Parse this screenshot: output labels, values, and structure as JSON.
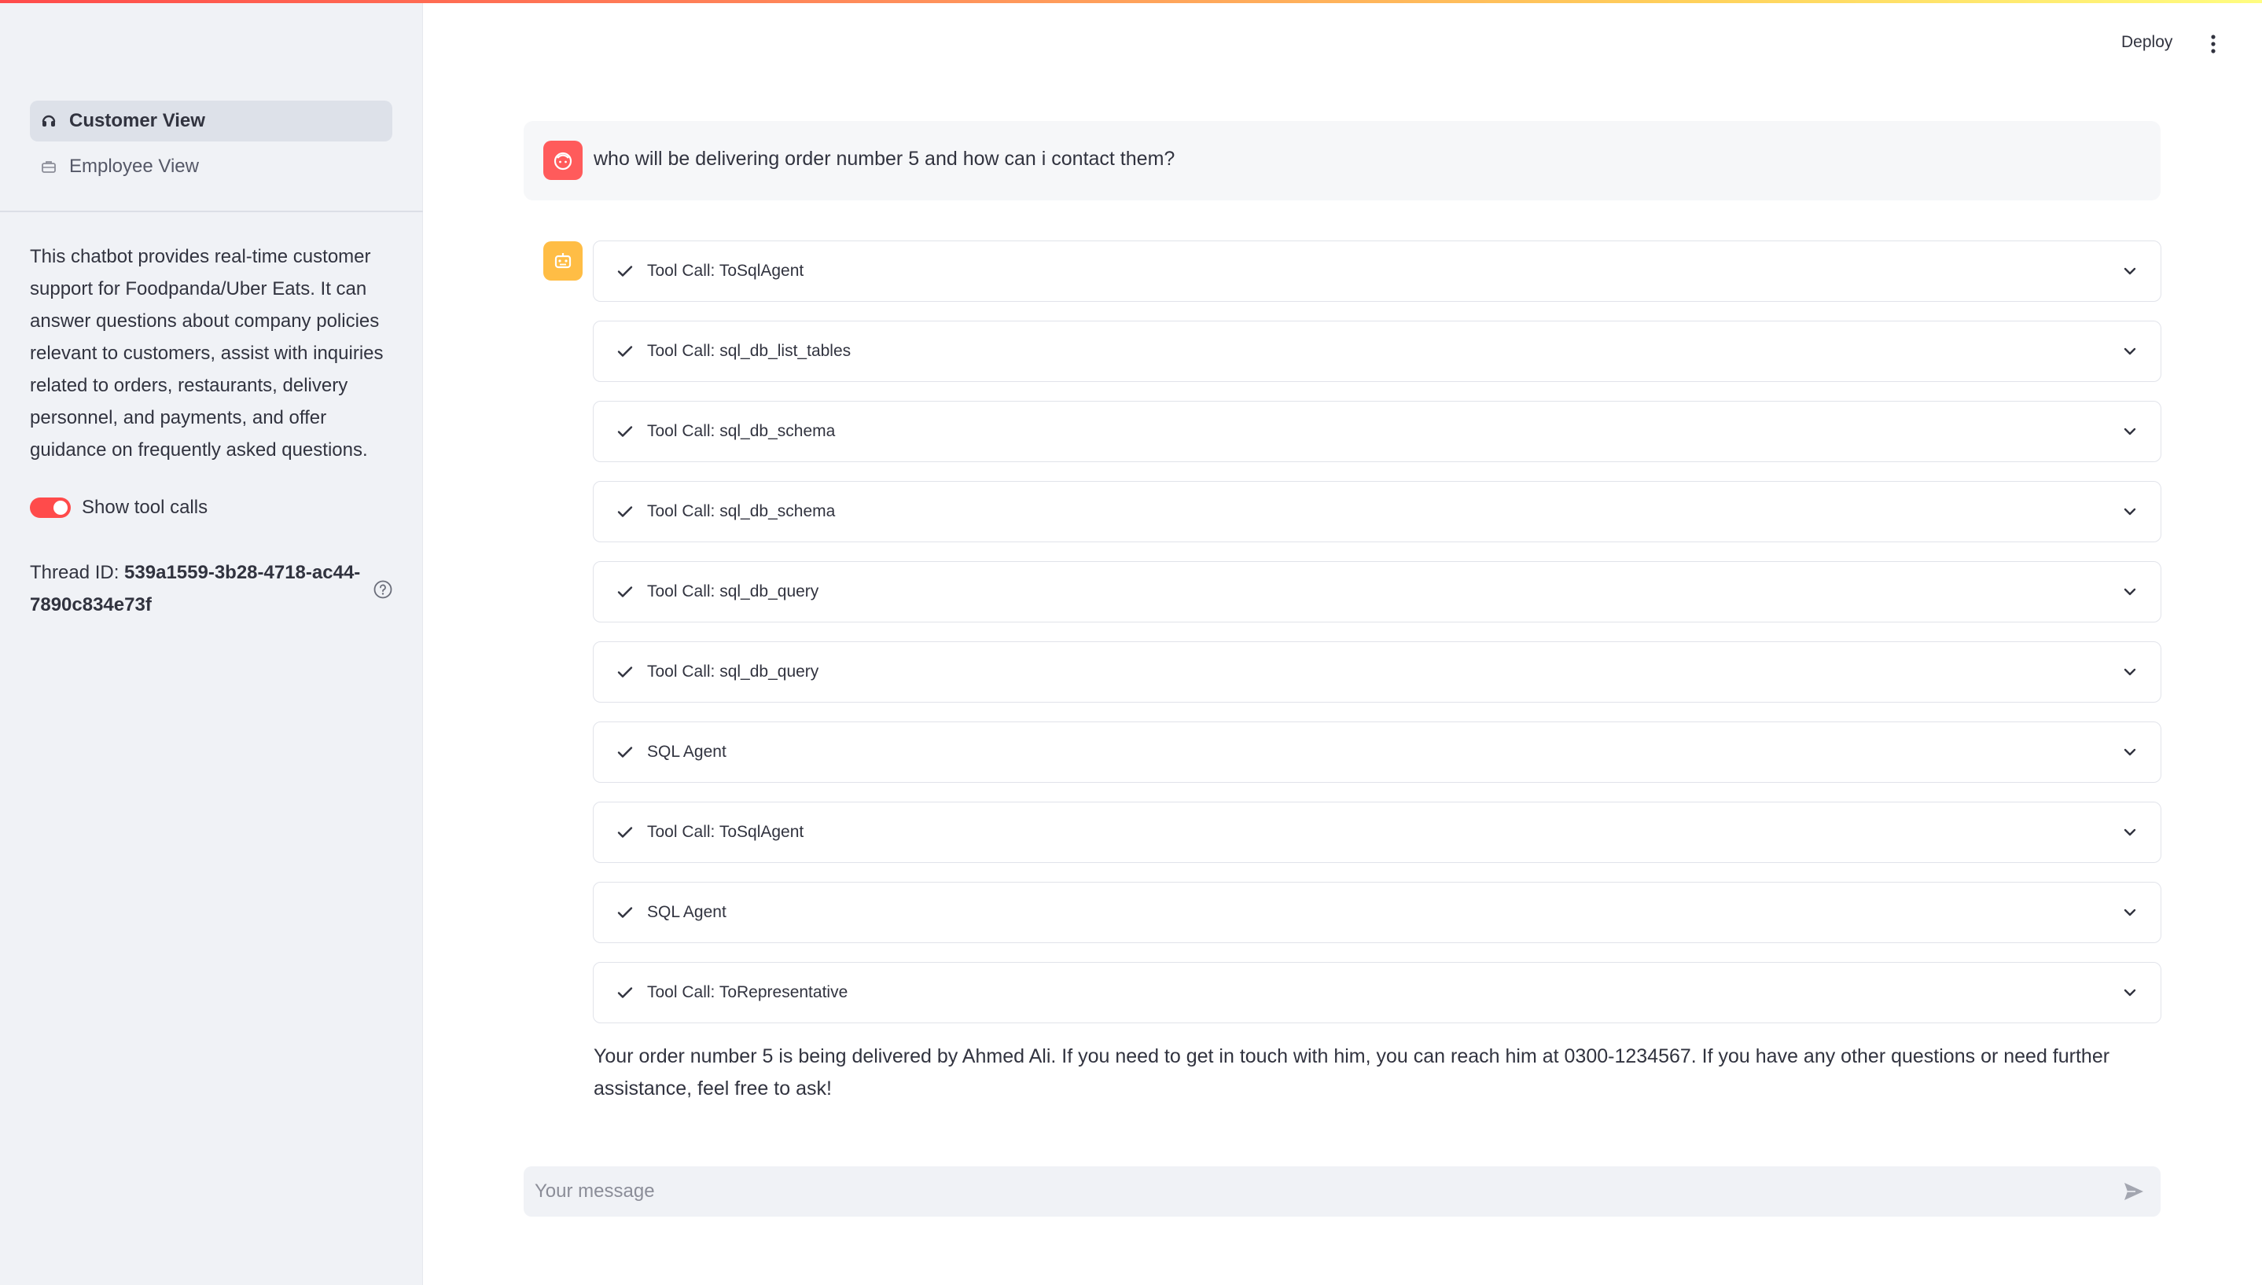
{
  "header": {
    "deploy_label": "Deploy"
  },
  "sidebar": {
    "nav": [
      {
        "label": "Customer View",
        "icon": "headset-icon",
        "active": true
      },
      {
        "label": "Employee View",
        "icon": "briefcase-icon",
        "active": false
      }
    ],
    "about": "This chatbot provides real-time customer support for Foodpanda/Uber Eats. It can answer questions about company policies relevant to customers, assist with inquiries related to orders, restaurants, delivery personnel, and payments, and offer guidance on frequently asked questions.",
    "toggle_label": "Show tool calls",
    "toggle_on": true,
    "thread_label": "Thread ID: ",
    "thread_id": "539a1559-3b28-4718-ac44-7890c834e73f"
  },
  "chat": {
    "user_message": "who will be delivering order number 5 and how can i contact them?",
    "tool_calls": [
      {
        "label": "Tool Call: ToSqlAgent"
      },
      {
        "label": "Tool Call: sql_db_list_tables"
      },
      {
        "label": "Tool Call: sql_db_schema"
      },
      {
        "label": "Tool Call: sql_db_schema"
      },
      {
        "label": "Tool Call: sql_db_query"
      },
      {
        "label": "Tool Call: sql_db_query"
      },
      {
        "label": "SQL Agent"
      },
      {
        "label": "Tool Call: ToSqlAgent"
      },
      {
        "label": "SQL Agent"
      },
      {
        "label": "Tool Call: ToRepresentative"
      }
    ],
    "assistant_message": "Your order number 5 is being delivered by Ahmed Ali. If you need to get in touch with him, you can reach him at 0300-1234567. If you have any other questions or need further assistance, feel free to ask!"
  },
  "input": {
    "placeholder": "Your message"
  },
  "colors": {
    "accent": "#ff4b4b",
    "user_avatar": "#ff5b5b",
    "bot_avatar": "#ffbd45",
    "sidebar_bg": "#f0f2f6"
  }
}
